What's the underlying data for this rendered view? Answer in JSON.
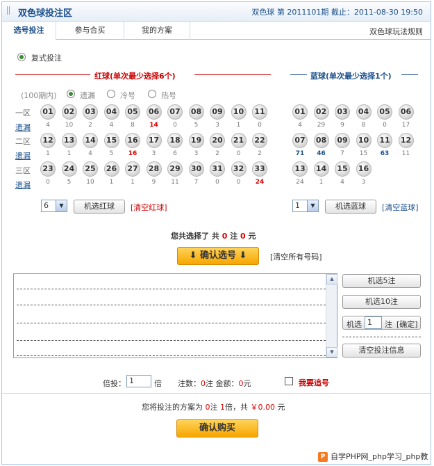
{
  "header": {
    "title": "双色球投注区",
    "issue_text": "双色球  第  2011101期  截止：2011-08-30 19:50"
  },
  "tabs": [
    {
      "label": "选号投注"
    },
    {
      "label": "参与合买"
    },
    {
      "label": "我的方案"
    }
  ],
  "rules_link": "双色球玩法规则",
  "bet_mode": {
    "label": "复式投注"
  },
  "red_section": {
    "title": "红球(单次最少选择6个)"
  },
  "blue_section": {
    "title": "蓝球(单次最少选择1个)"
  },
  "filters": {
    "period": "(100期内)",
    "options": [
      "遗漏",
      "冷号",
      "热号"
    ]
  },
  "zones": [
    "一区",
    "二区",
    "三区"
  ],
  "miss_label": "遗漏",
  "red_balls": [
    [
      "01",
      "02",
      "03",
      "04",
      "05",
      "06",
      "07",
      "08",
      "09",
      "10",
      "11"
    ],
    [
      "12",
      "13",
      "14",
      "15",
      "16",
      "17",
      "18",
      "19",
      "20",
      "21",
      "22"
    ],
    [
      "23",
      "24",
      "25",
      "26",
      "27",
      "28",
      "29",
      "30",
      "31",
      "32",
      "33"
    ]
  ],
  "red_stats": [
    [
      "4",
      "10",
      "2",
      "4",
      "8",
      "14",
      "0",
      "5",
      "3",
      "1",
      "0"
    ],
    [
      "1",
      "1",
      "4",
      "5",
      "16",
      "3",
      "6",
      "3",
      "2",
      "0",
      "2"
    ],
    [
      "0",
      "5",
      "10",
      "1",
      "1",
      "9",
      "11",
      "7",
      "0",
      "0",
      "24"
    ]
  ],
  "blue_balls": [
    [
      "01",
      "02",
      "03",
      "04",
      "05",
      "06"
    ],
    [
      "07",
      "08",
      "09",
      "10",
      "11",
      "12"
    ],
    [
      "13",
      "14",
      "15",
      "16"
    ]
  ],
  "blue_stats": [
    [
      "4",
      "29",
      "9",
      "8",
      "0",
      "17"
    ],
    [
      "71",
      "46",
      "7",
      "15",
      "63",
      "11"
    ],
    [
      "24",
      "1",
      "4",
      "3"
    ]
  ],
  "red_controls": {
    "select_value": "6",
    "random_button": "机选红球",
    "clear_link": "[清空红球]"
  },
  "blue_controls": {
    "select_value": "1",
    "random_button": "机选蓝球",
    "clear_link": "[清空蓝球]"
  },
  "summary": {
    "prefix": "您共选择了  共",
    "bets": "0",
    "mid": "注",
    "amount": "0",
    "suffix": "元"
  },
  "confirm_pick_button": "确认选号",
  "clear_all_link": "[清空所有号码]",
  "side_buttons": {
    "random5": "机选5注",
    "random10": "机选10注",
    "random_n_prefix": "机选",
    "random_n_value": "1",
    "random_n_unit": "注",
    "random_n_confirm": "[确定]",
    "clear_info": "清空投注信息"
  },
  "multiplier_row": {
    "label": "倍投：",
    "value": "1",
    "unit": "倍",
    "bets_label": "注数：",
    "bets": "0",
    "bets_unit": "注",
    "money_label": "金额：",
    "money": "0",
    "money_unit": "元",
    "chase_label": "我要追号"
  },
  "final_line": {
    "prefix": "您将投注的方案为",
    "bets": "0",
    "bets_unit": "注",
    "times": "1",
    "times_unit": "倍，共",
    "amount": "￥0.00",
    "amount_unit": "元"
  },
  "buy_button": "确认购买",
  "watermark": "自学PHP网_php学习_php教",
  "colors": {
    "red": "#cc0000",
    "blue": "#1a4f8b",
    "accent": "#f7a600"
  }
}
